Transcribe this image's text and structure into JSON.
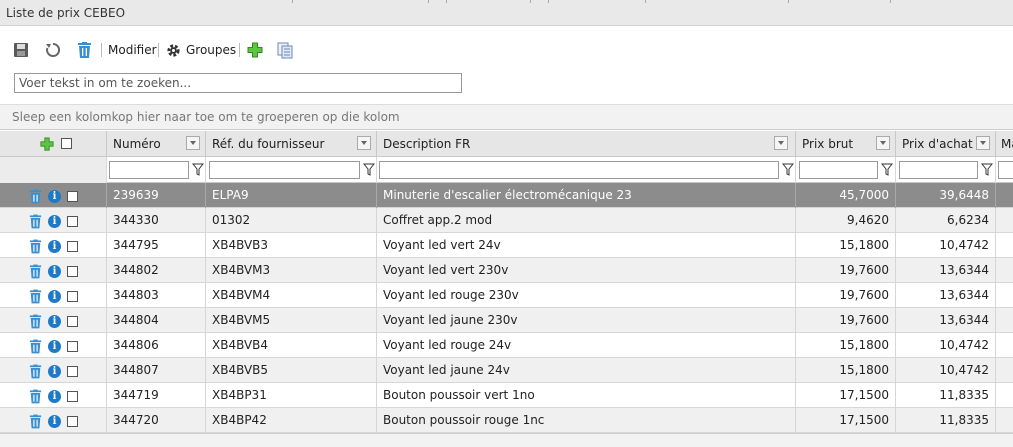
{
  "window": {
    "title": "Liste de prix CEBEO"
  },
  "toolbar": {
    "save_icon": "save-icon",
    "refresh_icon": "refresh-icon",
    "delete_icon": "trash-icon",
    "modify_label": "Modifier",
    "groups_label": "Groupes",
    "add_icon": "plus-icon",
    "copy_icon": "copy-icon"
  },
  "search": {
    "placeholder": "Voer tekst in om te zoeken..."
  },
  "group_panel": {
    "hint": "Sleep een kolomkop hier naar toe om te groeperen op die kolom"
  },
  "columns": {
    "numero": "Numéro",
    "ref": "Réf. du fournisseur",
    "desc": "Description FR",
    "brut": "Prix brut",
    "achat": "Prix d'achat",
    "more": "Ma"
  },
  "rows": [
    {
      "numero": "239639",
      "ref": "ELPA9",
      "desc": "Minuterie d'escalier électromécanique 23",
      "brut": "45,7000",
      "achat": "39,6448"
    },
    {
      "numero": "344330",
      "ref": "01302",
      "desc": "Coffret app.2 mod",
      "brut": "9,4620",
      "achat": "6,6234"
    },
    {
      "numero": "344795",
      "ref": "XB4BVB3",
      "desc": "Voyant led vert 24v",
      "brut": "15,1800",
      "achat": "10,4742"
    },
    {
      "numero": "344802",
      "ref": "XB4BVM3",
      "desc": "Voyant led vert 230v",
      "brut": "19,7600",
      "achat": "13,6344"
    },
    {
      "numero": "344803",
      "ref": "XB4BVM4",
      "desc": "Voyant led rouge 230v",
      "brut": "19,7600",
      "achat": "13,6344"
    },
    {
      "numero": "344804",
      "ref": "XB4BVM5",
      "desc": "Voyant led jaune 230v",
      "brut": "19,7600",
      "achat": "13,6344"
    },
    {
      "numero": "344806",
      "ref": "XB4BVB4",
      "desc": "Voyant led rouge 24v",
      "brut": "15,1800",
      "achat": "10,4742"
    },
    {
      "numero": "344807",
      "ref": "XB4BVB5",
      "desc": "Voyant led jaune 24v",
      "brut": "15,1800",
      "achat": "10,4742"
    },
    {
      "numero": "344719",
      "ref": "XB4BP31",
      "desc": "Bouton poussoir vert 1no",
      "brut": "17,1500",
      "achat": "11,8335"
    },
    {
      "numero": "344720",
      "ref": "XB4BP42",
      "desc": "Bouton poussoir rouge 1nc",
      "brut": "17,1500",
      "achat": "11,8335"
    }
  ],
  "selected_row": 0,
  "colors": {
    "accent_blue": "#1e7ac8",
    "add_green": "#3fae2a",
    "selected_row": "#8c8c8c"
  }
}
